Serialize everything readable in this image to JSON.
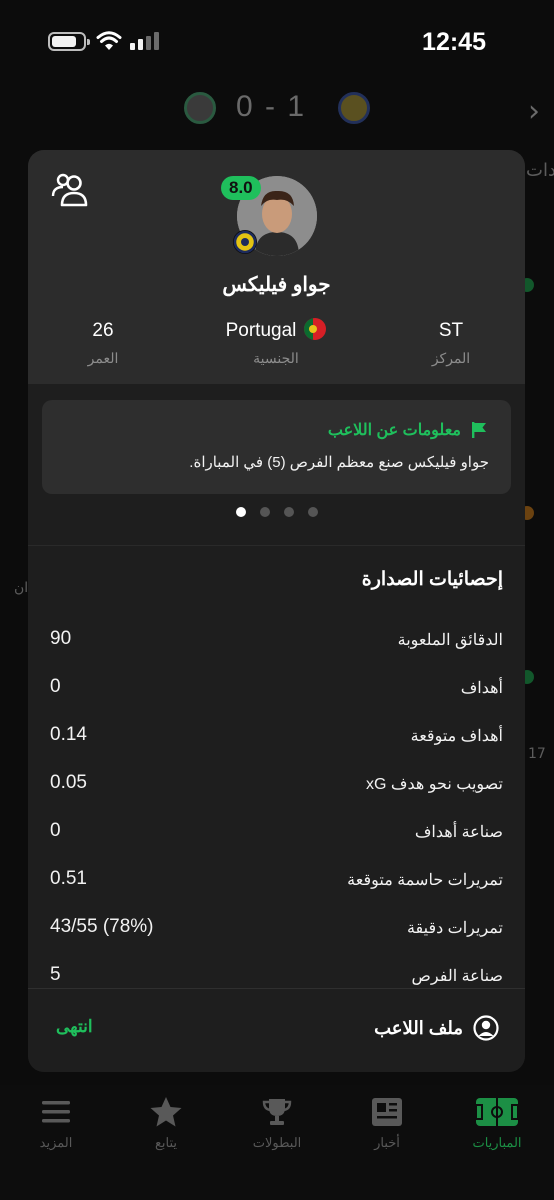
{
  "status_bar": {
    "time": "12:45",
    "battery_level": 0.8
  },
  "match": {
    "home_score": "1",
    "separator": "-",
    "away_score": "0"
  },
  "player": {
    "name": "جواو فيليكس",
    "rating": "8.0",
    "position_value": "ST",
    "position_label": "المركز",
    "nationality_value": "Portugal",
    "nationality_label": "الجنسية",
    "age_value": "26",
    "age_label": "العمر"
  },
  "fact": {
    "title": "معلومات عن اللاعب",
    "text": "جواو فيليكس صنع معظم الفرص (5) في المباراة.",
    "page_count": 4,
    "active_page": 1
  },
  "stats": {
    "title": "إحصائيات الصدارة",
    "rows": [
      {
        "label": "الدقائق الملعوبة",
        "value": "90"
      },
      {
        "label": "أهداف",
        "value": "0"
      },
      {
        "label": "أهداف متوقعة",
        "value": "0.14"
      },
      {
        "label": "تصويب نحو هدف xG",
        "value": "0.05"
      },
      {
        "label": "صناعة أهداف",
        "value": "0"
      },
      {
        "label": "تمريرات حاسمة متوقعة",
        "value": "0.51"
      },
      {
        "label": "تمريرات دقيقة",
        "value": "43/55 (78%)"
      },
      {
        "label": "صناعة الفرص",
        "value": "5"
      }
    ]
  },
  "actions": {
    "done_label": "انتهى",
    "profile_label": "ملف اللاعب"
  },
  "tabs": [
    {
      "label": "المباريات",
      "icon": "pitch-icon"
    },
    {
      "label": "أخبار",
      "icon": "newspaper-icon"
    },
    {
      "label": "البطولات",
      "icon": "trophy-icon"
    },
    {
      "label": "يتابع",
      "icon": "star-icon"
    },
    {
      "label": "المزيد",
      "icon": "menu-icon"
    }
  ],
  "background": {
    "frag_1": "ان",
    "frag_2": "17",
    "frag_3": "دات"
  },
  "colors": {
    "accent": "#1fbf5c",
    "modal_bg": "#1e1e1e",
    "header_bg": "#2c2c2c",
    "page_bg": "#0c0c0c"
  }
}
